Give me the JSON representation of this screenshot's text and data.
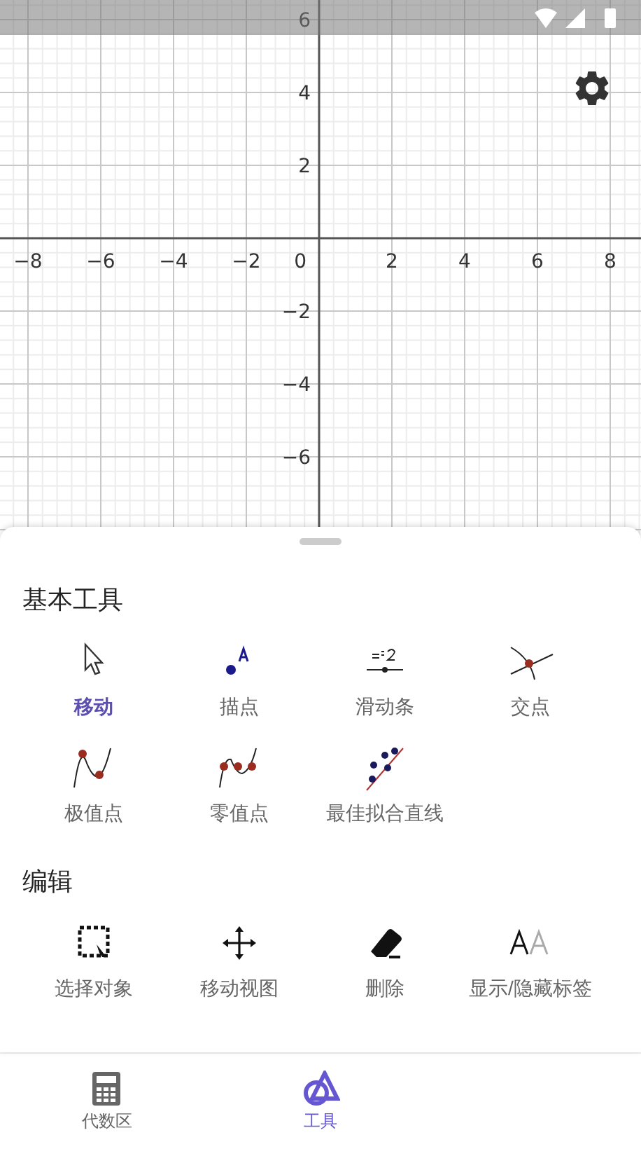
{
  "graph": {
    "x_labels": [
      "−8",
      "−6",
      "−4",
      "−2",
      "2",
      "4",
      "6",
      "8"
    ],
    "origin": "0",
    "y_labels": [
      "6",
      "4",
      "2",
      "−2",
      "−4",
      "−6"
    ]
  },
  "sections": [
    {
      "title": "基本工具",
      "tools": [
        {
          "label": "移动",
          "selected": true
        },
        {
          "label": "描点",
          "selected": false
        },
        {
          "label": "滑动条",
          "selected": false
        },
        {
          "label": "交点",
          "selected": false
        },
        {
          "label": "极值点",
          "selected": false
        },
        {
          "label": "零值点",
          "selected": false
        },
        {
          "label": "最佳拟合直线",
          "selected": false
        }
      ]
    },
    {
      "title": "编辑",
      "tools": [
        {
          "label": "选择对象",
          "selected": false
        },
        {
          "label": "移动视图",
          "selected": false
        },
        {
          "label": "删除",
          "selected": false
        },
        {
          "label": "显示/隐藏标签",
          "selected": false
        }
      ]
    }
  ],
  "nav": [
    {
      "label": "代数区",
      "selected": false
    },
    {
      "label": "工具",
      "selected": true
    }
  ]
}
